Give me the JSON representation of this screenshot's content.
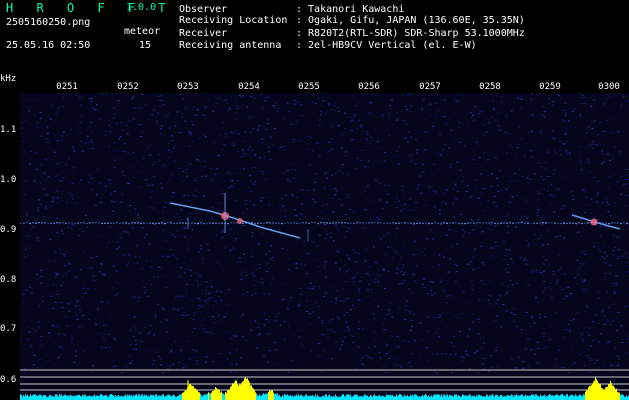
{
  "app": {
    "logo": "H R O F F T",
    "version": "1.0.0",
    "filename": "2505160250.png",
    "datetime": "25.05.16 02:50",
    "meteor_label": "meteor",
    "meteor_count": "15"
  },
  "info": [
    {
      "label": "Observer",
      "value": ": Takanori Kawachi"
    },
    {
      "label": "Receiving Location",
      "value": ": Ogaki, Gifu, JAPAN (136.60E, 35.35N)"
    },
    {
      "label": "Receiver",
      "value": ": R820T2(RTL-SDR) SDR-Sharp 53.1000MHz"
    },
    {
      "label": "Receiving antenna",
      "value": ": 2el-HB9CV Vertical (el. E-W)"
    }
  ],
  "axis": {
    "y_unit": "kHz",
    "time_labels": [
      "0251",
      "0252",
      "0253",
      "0254",
      "0255",
      "0256",
      "0257",
      "0258",
      "0259",
      "0300"
    ],
    "freq_labels": [
      "1.1",
      "1.0",
      "0.9",
      "0.8",
      "0.7",
      "0.6"
    ]
  },
  "colors": {
    "background": "#000000",
    "noise": "#1a1f8a",
    "signal": "#6fa8ff",
    "meteor_hot": "#ff6680",
    "spectrum": "#00e5ff",
    "spectrum_peak": "#ffff00",
    "logo": "#00ff9c",
    "text": "#ffffff"
  }
}
